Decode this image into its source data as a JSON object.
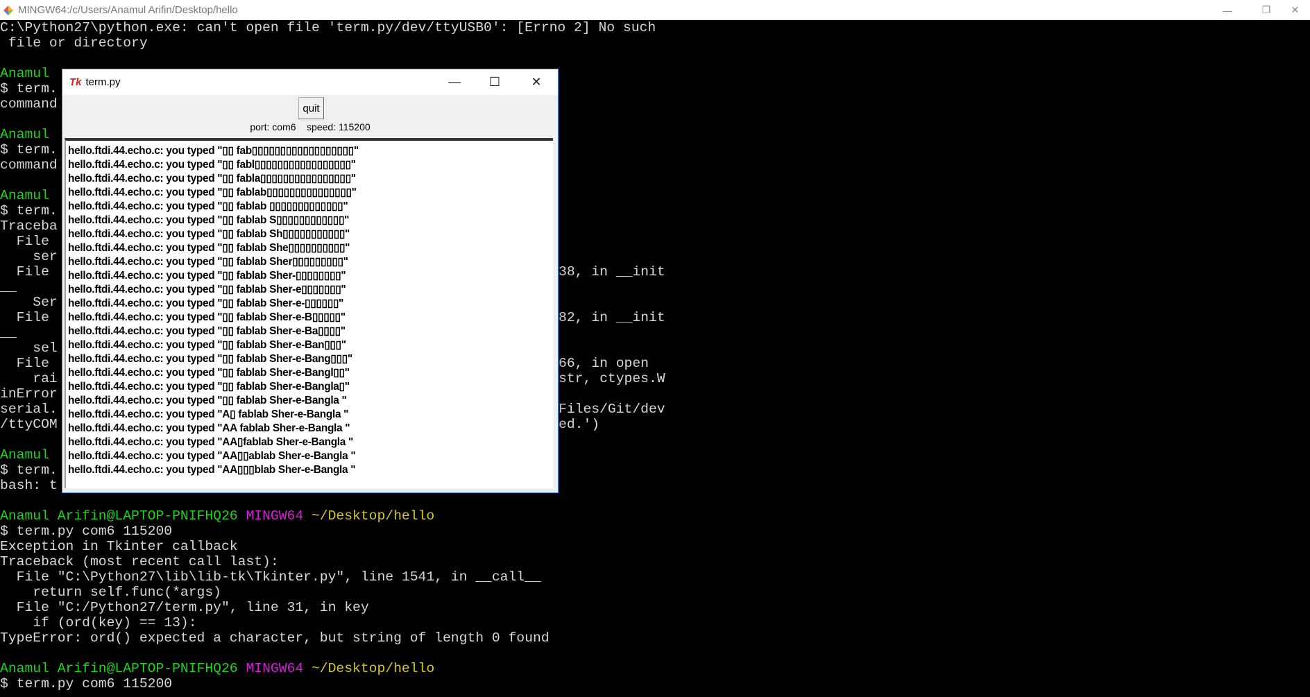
{
  "window": {
    "title": "MINGW64:/c/Users/Anamul Arifin/Desktop/hello",
    "minimize": "—",
    "restore": "❐",
    "close": "✕"
  },
  "terminal": [
    {
      "l": [
        {
          "t": "C:\\Python27\\python.exe: can't open file 'term.py/dev/ttyUSB0': [Errno 2] No such",
          "c": ""
        }
      ]
    },
    {
      "l": [
        {
          "t": " file or directory",
          "c": ""
        }
      ]
    },
    {
      "l": []
    },
    {
      "l": [
        {
          "t": "Anamul",
          "c": "g"
        }
      ]
    },
    {
      "l": [
        {
          "t": "$ term.",
          "c": ""
        }
      ]
    },
    {
      "l": [
        {
          "t": "command",
          "c": ""
        }
      ]
    },
    {
      "l": []
    },
    {
      "l": [
        {
          "t": "Anamul",
          "c": "g"
        }
      ]
    },
    {
      "l": [
        {
          "t": "$ term.",
          "c": ""
        }
      ]
    },
    {
      "l": [
        {
          "t": "command",
          "c": ""
        }
      ]
    },
    {
      "l": []
    },
    {
      "l": [
        {
          "t": "Anamul",
          "c": "g"
        }
      ]
    },
    {
      "l": [
        {
          "t": "$ term.",
          "c": ""
        }
      ]
    },
    {
      "l": [
        {
          "t": "Traceba",
          "c": ""
        }
      ]
    },
    {
      "l": [
        {
          "t": "  File",
          "c": ""
        }
      ]
    },
    {
      "l": [
        {
          "t": "    ser",
          "c": ""
        }
      ]
    },
    {
      "l": [
        {
          "t": "  File",
          "c": ""
        }
      ],
      "r": "38, in __init"
    },
    {
      "l": [
        {
          "t": "__",
          "c": ""
        }
      ]
    },
    {
      "l": [
        {
          "t": "    Ser",
          "c": ""
        }
      ]
    },
    {
      "l": [
        {
          "t": "  File",
          "c": ""
        }
      ],
      "r": "82, in __init"
    },
    {
      "l": [
        {
          "t": "__",
          "c": ""
        }
      ]
    },
    {
      "l": [
        {
          "t": "    sel",
          "c": ""
        }
      ]
    },
    {
      "l": [
        {
          "t": "  File",
          "c": ""
        }
      ],
      "r": "66, in open"
    },
    {
      "l": [
        {
          "t": "    rai",
          "c": ""
        }
      ],
      "r": "str, ctypes.W"
    },
    {
      "l": [
        {
          "t": "inError",
          "c": ""
        }
      ]
    },
    {
      "l": [
        {
          "t": "serial.",
          "c": ""
        }
      ],
      "r": "Files/Git/dev"
    },
    {
      "l": [
        {
          "t": "/ttyCOM",
          "c": ""
        }
      ],
      "r": "ed.')"
    },
    {
      "l": []
    },
    {
      "l": [
        {
          "t": "Anamul",
          "c": "g"
        }
      ]
    },
    {
      "l": [
        {
          "t": "$ term.",
          "c": ""
        }
      ]
    },
    {
      "l": [
        {
          "t": "bash: t",
          "c": ""
        }
      ]
    },
    {
      "l": []
    },
    {
      "l": [
        {
          "t": "Anamul Arifin@LAPTOP-PNIFHQ26 ",
          "c": "g"
        },
        {
          "t": "MINGW64 ",
          "c": "m"
        },
        {
          "t": "~/Desktop/hello",
          "c": "y"
        }
      ]
    },
    {
      "l": [
        {
          "t": "$ term.py com6 115200",
          "c": ""
        }
      ]
    },
    {
      "l": [
        {
          "t": "Exception in Tkinter callback",
          "c": ""
        }
      ]
    },
    {
      "l": [
        {
          "t": "Traceback (most recent call last):",
          "c": ""
        }
      ]
    },
    {
      "l": [
        {
          "t": "  File \"C:\\Python27\\lib\\lib-tk\\Tkinter.py\", line 1541, in __call__",
          "c": ""
        }
      ]
    },
    {
      "l": [
        {
          "t": "    return self.func(*args)",
          "c": ""
        }
      ]
    },
    {
      "l": [
        {
          "t": "  File \"C:/Python27/term.py\", line 31, in key",
          "c": ""
        }
      ]
    },
    {
      "l": [
        {
          "t": "    if (ord(key) == 13):",
          "c": ""
        }
      ]
    },
    {
      "l": [
        {
          "t": "TypeError: ord() expected a character, but string of length 0 found",
          "c": ""
        }
      ]
    },
    {
      "l": []
    },
    {
      "l": [
        {
          "t": "Anamul Arifin@LAPTOP-PNIFHQ26 ",
          "c": "g"
        },
        {
          "t": "MINGW64 ",
          "c": "m"
        },
        {
          "t": "~/Desktop/hello",
          "c": "y"
        }
      ]
    },
    {
      "l": [
        {
          "t": "$ term.py com6 115200",
          "c": ""
        }
      ]
    }
  ],
  "tk": {
    "title": "term.py",
    "icon": "Tk",
    "quit_label": "quit",
    "status": "port: com6    speed: 115200",
    "lines": [
      "hello.ftdi.44.echo.c: you typed \"▯▯ fab▯▯▯▯▯▯▯▯▯▯▯▯▯▯▯▯▯▯\"",
      "hello.ftdi.44.echo.c: you typed \"▯▯ fabl▯▯▯▯▯▯▯▯▯▯▯▯▯▯▯▯▯\"",
      "hello.ftdi.44.echo.c: you typed \"▯▯ fabla▯▯▯▯▯▯▯▯▯▯▯▯▯▯▯▯\"",
      "hello.ftdi.44.echo.c: you typed \"▯▯ fablab▯▯▯▯▯▯▯▯▯▯▯▯▯▯▯\"",
      "hello.ftdi.44.echo.c: you typed \"▯▯ fablab ▯▯▯▯▯▯▯▯▯▯▯▯▯\"",
      "hello.ftdi.44.echo.c: you typed \"▯▯ fablab S▯▯▯▯▯▯▯▯▯▯▯▯\"",
      "hello.ftdi.44.echo.c: you typed \"▯▯ fablab Sh▯▯▯▯▯▯▯▯▯▯▯\"",
      "hello.ftdi.44.echo.c: you typed \"▯▯ fablab She▯▯▯▯▯▯▯▯▯▯\"",
      "hello.ftdi.44.echo.c: you typed \"▯▯ fablab Sher▯▯▯▯▯▯▯▯▯\"",
      "hello.ftdi.44.echo.c: you typed \"▯▯ fablab Sher-▯▯▯▯▯▯▯▯\"",
      "hello.ftdi.44.echo.c: you typed \"▯▯ fablab Sher-e▯▯▯▯▯▯▯\"",
      "hello.ftdi.44.echo.c: you typed \"▯▯ fablab Sher-e-▯▯▯▯▯▯\"",
      "hello.ftdi.44.echo.c: you typed \"▯▯ fablab Sher-e-B▯▯▯▯▯\"",
      "hello.ftdi.44.echo.c: you typed \"▯▯ fablab Sher-e-Ba▯▯▯▯\"",
      "hello.ftdi.44.echo.c: you typed \"▯▯ fablab Sher-e-Ban▯▯▯\"",
      "hello.ftdi.44.echo.c: you typed \"▯▯ fablab Sher-e-Bang▯▯▯\"",
      "hello.ftdi.44.echo.c: you typed \"▯▯ fablab Sher-e-Bangl▯▯\"",
      "hello.ftdi.44.echo.c: you typed \"▯▯ fablab Sher-e-Bangla▯\"",
      "hello.ftdi.44.echo.c: you typed \"▯▯ fablab Sher-e-Bangla \"",
      "hello.ftdi.44.echo.c: you typed \"A▯ fablab Sher-e-Bangla \"",
      "hello.ftdi.44.echo.c: you typed \"AA fablab Sher-e-Bangla \"",
      "hello.ftdi.44.echo.c: you typed \"AA▯fablab Sher-e-Bangla \"",
      "hello.ftdi.44.echo.c: you typed \"AA▯▯ablab Sher-e-Bangla \"",
      "hello.ftdi.44.echo.c: you typed \"AA▯▯▯blab Sher-e-Bangla \""
    ]
  }
}
